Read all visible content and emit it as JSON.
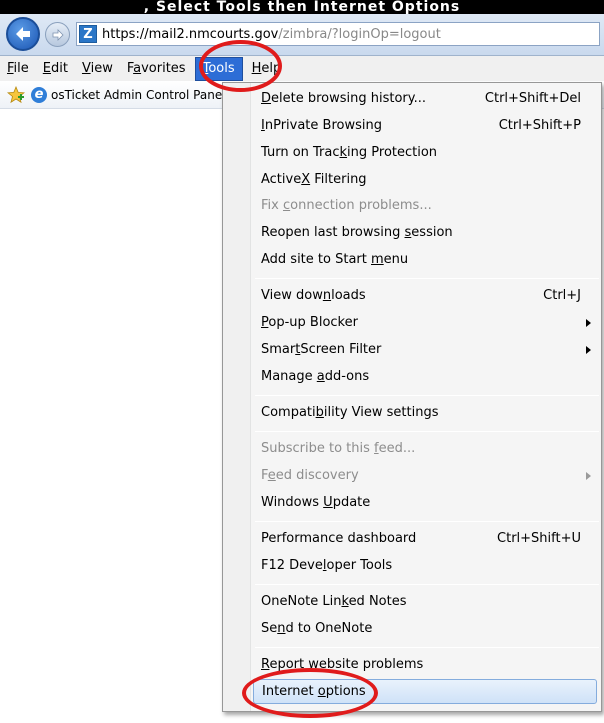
{
  "caption": ", Select Tools then Internet Options",
  "address": {
    "site_icon_letter": "Z",
    "protocol": "https://",
    "host": "mail2.nmcourts.gov",
    "path": "/zimbra/?loginOp=logout"
  },
  "menubar": {
    "file": {
      "pre": "",
      "ul": "F",
      "post": "ile"
    },
    "edit": {
      "pre": "",
      "ul": "E",
      "post": "dit"
    },
    "view": {
      "pre": "",
      "ul": "V",
      "post": "iew"
    },
    "favorites": {
      "pre": "F",
      "ul": "a",
      "post": "vorites"
    },
    "tools": {
      "pre": "",
      "ul": "T",
      "post": "ools"
    },
    "help": {
      "pre": "",
      "ul": "H",
      "post": "elp"
    }
  },
  "favorites_bar": {
    "link": "osTicket  Admin Control Panel"
  },
  "tools_menu": {
    "delete_history": {
      "pre": "",
      "ul": "D",
      "post": "elete browsing history...",
      "shortcut": "Ctrl+Shift+Del"
    },
    "inprivate": {
      "pre": "",
      "ul": "I",
      "post": "nPrivate Browsing",
      "shortcut": "Ctrl+Shift+P"
    },
    "tracking": {
      "pre": "Turn on Trac",
      "ul": "k",
      "post": "ing Protection"
    },
    "activex": {
      "pre": "Active",
      "ul": "X",
      "post": " Filtering"
    },
    "fix_connection": {
      "pre": "Fix ",
      "ul": "c",
      "post": "onnection problems..."
    },
    "reopen_session": {
      "pre": "Reopen last browsing ",
      "ul": "s",
      "post": "ession"
    },
    "add_start": {
      "pre": "Add site to Start ",
      "ul": "m",
      "post": "enu"
    },
    "downloads": {
      "pre": "View dow",
      "ul": "n",
      "post": "loads",
      "shortcut": "Ctrl+J"
    },
    "popup": {
      "pre": "",
      "ul": "P",
      "post": "op-up Blocker"
    },
    "smartscreen": {
      "pre": "Smar",
      "ul": "t",
      "post": "Screen Filter"
    },
    "addons": {
      "pre": "Manage ",
      "ul": "a",
      "post": "dd-ons"
    },
    "compat": {
      "pre": "Compati",
      "ul": "b",
      "post": "ility View settings"
    },
    "subscribe": {
      "pre": "Subscribe to this ",
      "ul": "f",
      "post": "eed..."
    },
    "feed_discovery": {
      "pre": "F",
      "ul": "e",
      "post": "ed discovery"
    },
    "windows_update": {
      "pre": "Windows ",
      "ul": "U",
      "post": "pdate"
    },
    "performance": {
      "pre": "Performance dashboard",
      "ul": "",
      "post": "",
      "shortcut": "Ctrl+Shift+U"
    },
    "f12": {
      "pre": "F12 Deve",
      "ul": "l",
      "post": "oper Tools"
    },
    "onenote_linked": {
      "pre": "OneNote Lin",
      "ul": "k",
      "post": "ed Notes"
    },
    "send_onenote": {
      "pre": "Se",
      "ul": "n",
      "post": "d to OneNote"
    },
    "report": {
      "pre": "",
      "ul": "R",
      "post": "eport website problems"
    },
    "internet_options": {
      "pre": "Internet ",
      "ul": "o",
      "post": "ptions"
    }
  },
  "colors": {
    "annotation": "#e01b1b",
    "menu_active": "#2d6dd6",
    "highlight_border": "#84acdd"
  }
}
